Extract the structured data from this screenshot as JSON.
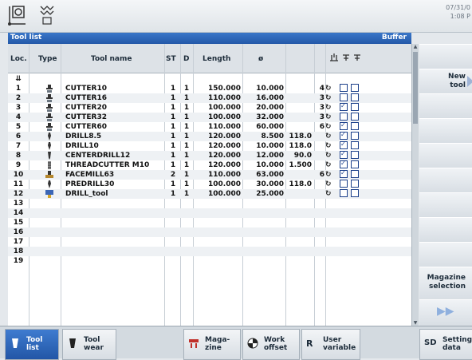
{
  "header": {
    "datetime_line1": "07/31/0",
    "datetime_line2": "1:08 P"
  },
  "title": {
    "left": "Tool list",
    "right": "Buffer"
  },
  "columns": {
    "loc": "Loc.",
    "type": "Type",
    "name": "Tool name",
    "st": "ST",
    "d": "D",
    "length": "Length",
    "dia": "ø"
  },
  "buffer_marker": "⇊",
  "rows": [
    {
      "loc": "1",
      "name": "CUTTER10",
      "st": "1",
      "d": "1",
      "length": "150.000",
      "dia": "10.000",
      "extra": "",
      "edge": "4",
      "c1": false,
      "c2": false,
      "icon": "mill"
    },
    {
      "loc": "2",
      "name": "CUTTER16",
      "st": "1",
      "d": "1",
      "length": "110.000",
      "dia": "16.000",
      "extra": "",
      "edge": "3",
      "c1": false,
      "c2": false,
      "icon": "mill"
    },
    {
      "loc": "3",
      "name": "CUTTER20",
      "st": "1",
      "d": "1",
      "length": "100.000",
      "dia": "20.000",
      "extra": "",
      "edge": "3",
      "c1": true,
      "c2": false,
      "icon": "mill"
    },
    {
      "loc": "4",
      "name": "CUTTER32",
      "st": "1",
      "d": "1",
      "length": "100.000",
      "dia": "32.000",
      "extra": "",
      "edge": "3",
      "c1": false,
      "c2": false,
      "icon": "mill"
    },
    {
      "loc": "5",
      "name": "CUTTER60",
      "st": "1",
      "d": "1",
      "length": "110.000",
      "dia": "60.000",
      "extra": "",
      "edge": "6",
      "c1": true,
      "c2": false,
      "icon": "mill"
    },
    {
      "loc": "6",
      "name": "DRILL8.5",
      "st": "1",
      "d": "1",
      "length": "120.000",
      "dia": "8.500",
      "extra": "118.0",
      "edge": "",
      "c1": true,
      "c2": false,
      "icon": "drill"
    },
    {
      "loc": "7",
      "name": "DRILL10",
      "st": "1",
      "d": "1",
      "length": "120.000",
      "dia": "10.000",
      "extra": "118.0",
      "edge": "",
      "c1": true,
      "c2": false,
      "icon": "drill"
    },
    {
      "loc": "8",
      "name": "CENTERDRILL12",
      "st": "1",
      "d": "1",
      "length": "120.000",
      "dia": "12.000",
      "extra": "90.0",
      "edge": "",
      "c1": true,
      "c2": false,
      "icon": "centerdrill"
    },
    {
      "loc": "9",
      "name": "THREADCUTTER M10",
      "st": "1",
      "d": "1",
      "length": "120.000",
      "dia": "10.000",
      "extra": "1.500",
      "edge": "",
      "c1": true,
      "c2": false,
      "icon": "thread"
    },
    {
      "loc": "10",
      "name": "FACEMILL63",
      "st": "2",
      "d": "1",
      "length": "110.000",
      "dia": "63.000",
      "extra": "",
      "edge": "6",
      "c1": true,
      "c2": false,
      "icon": "facemill"
    },
    {
      "loc": "11",
      "name": "PREDRILL30",
      "st": "1",
      "d": "1",
      "length": "100.000",
      "dia": "30.000",
      "extra": "118.0",
      "edge": "",
      "c1": false,
      "c2": false,
      "icon": "drill"
    },
    {
      "loc": "12",
      "name": "DRILL_tool",
      "st": "1",
      "d": "1",
      "length": "100.000",
      "dia": "25.000",
      "extra": "",
      "edge": "",
      "c1": false,
      "c2": false,
      "icon": "drilltool"
    },
    {
      "loc": "13"
    },
    {
      "loc": "14"
    },
    {
      "loc": "15"
    },
    {
      "loc": "16"
    },
    {
      "loc": "17"
    },
    {
      "loc": "18"
    },
    {
      "loc": "19"
    }
  ],
  "vertical_softkeys": {
    "new_tool": "New tool",
    "magazine_selection": "Magazine selection"
  },
  "horizontal_softkeys": {
    "tool_list": "Tool list",
    "tool_wear": "Tool wear",
    "magazine": "Maga-zine",
    "work_offset": "Work offset",
    "user_variable": "User variable",
    "setting_data": "Setting data"
  },
  "colors": {
    "accent": "#2a62b8",
    "check": "#1b3f8a"
  }
}
